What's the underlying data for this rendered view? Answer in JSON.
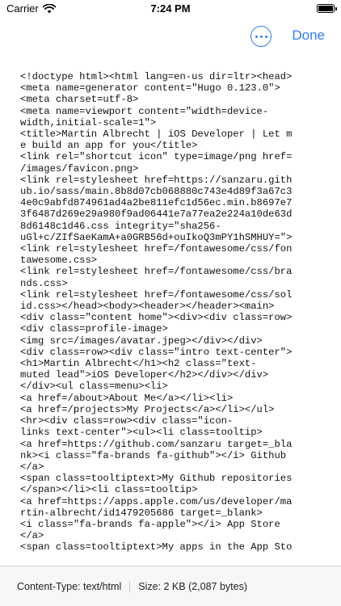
{
  "status_bar": {
    "carrier": "Carrier",
    "time": "7:24 PM",
    "battery_level": 1.0
  },
  "nav": {
    "more_icon": "ellipsis-circle-icon",
    "done_label": "Done",
    "accent_color": "#2f7df6"
  },
  "source_lines": [
    "<!doctype html><html lang=en-us dir=ltr><head>",
    "<meta name=generator content=\"Hugo 0.123.0\">",
    "<meta charset=utf-8>",
    "<meta name=viewport content=\"width=device-",
    "width,initial-scale=1\">",
    "<title>Martin Albrecht | iOS Developer | Let m",
    "e build an app for you</title>",
    "<link rel=\"shortcut icon\" type=image/png href=",
    "/images/favicon.png>",
    "<link rel=stylesheet href=https://sanzaru.gith",
    "ub.io/sass/main.8b8d07cb068880c743e4d89f3a67c3",
    "4e0c9abfd874961ad4a2be811efc1d56ec.min.b8697e7",
    "3f6487d269e29a980f9ad06441e7a77ea2e224a10de63d",
    "8d6148c1d46.css integrity=\"sha256-",
    "uGl+c/ZIfSaeKamA+a0GRB56d+ouIkoQ3mPY1hSMHUY=\">",
    "<link rel=stylesheet href=/fontawesome/css/fon",
    "tawesome.css>",
    "<link rel=stylesheet href=/fontawesome/css/bra",
    "nds.css>",
    "<link rel=stylesheet href=/fontawesome/css/sol",
    "id.css></head><body><header></header><main>",
    "<div class=\"content home\"><div><div class=row>",
    "<div class=profile-image>",
    "<img src=/images/avatar.jpeg></div></div>",
    "<div class=row><div class=\"intro text-center\">",
    "<h1>Martin Albrecht</h1><h2 class=\"text-",
    "muted lead\">iOS Developer</h2></div></div>",
    "</div><ul class=menu><li>",
    "<a href=/about>About Me</a></li><li>",
    "<a href=/projects>My Projects</a></li></ul>",
    "<hr><div class=row><div class=\"icon-",
    "links text-center\"><ul><li class=tooltip>",
    "<a href=https://github.com/sanzaru target=_bla",
    "nk><i class=\"fa-brands fa-github\"></i> Github",
    "</a>",
    "<span class=tooltiptext>My Github repositories",
    "</span></li><li class=tooltip>",
    "<a href=https://apps.apple.com/us/developer/ma",
    "rtin-albrecht/id1479205686 target=_blank>",
    "<i class=\"fa-brands fa-apple\"></i> App Store",
    "</a>",
    "<span class=tooltiptext>My apps in the App Sto"
  ],
  "footer": {
    "content_type": "Content-Type: text/html",
    "size": "Size: 2 KB (2,087 bytes)"
  }
}
